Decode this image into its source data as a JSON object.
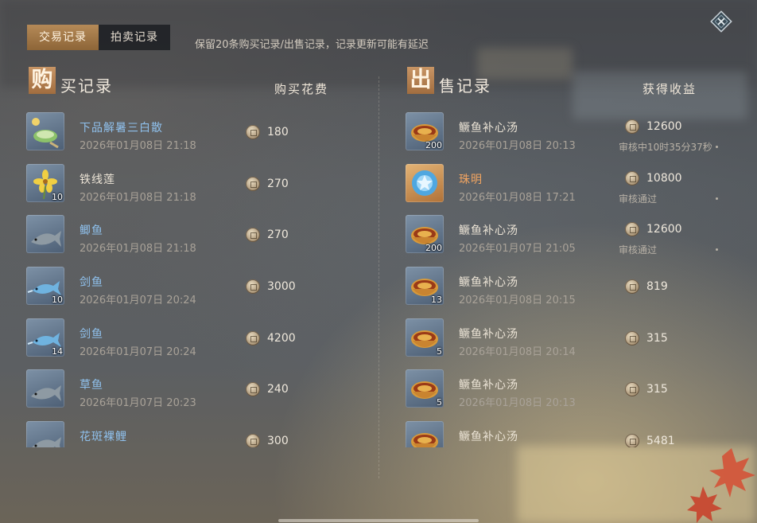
{
  "tabs": {
    "trade_records": "交易记录",
    "auction_records": "拍卖记录"
  },
  "notice": "保留20条购买记录/出售记录，记录更新可能有延迟",
  "buy": {
    "badge": "购",
    "title_rest": "买记录",
    "column": "购买花费",
    "items": [
      {
        "name": "下品解暑三白散",
        "time": "2026年01月08日 21:18",
        "price": "180",
        "count": "",
        "name_color": "blue",
        "icon": "herb-powder-icon"
      },
      {
        "name": "铁线莲",
        "time": "2026年01月08日 21:18",
        "price": "270",
        "count": "10",
        "name_color": "white",
        "icon": "flower-icon"
      },
      {
        "name": "鲫鱼",
        "time": "2026年01月08日 21:18",
        "price": "270",
        "count": "",
        "name_color": "blue",
        "icon": "fish-icon"
      },
      {
        "name": "剑鱼",
        "time": "2026年01月07日 20:24",
        "price": "3000",
        "count": "10",
        "name_color": "blue",
        "icon": "swordfish-icon"
      },
      {
        "name": "剑鱼",
        "time": "2026年01月07日 20:24",
        "price": "4200",
        "count": "14",
        "name_color": "blue",
        "icon": "swordfish-icon"
      },
      {
        "name": "草鱼",
        "time": "2026年01月07日 20:23",
        "price": "240",
        "count": "",
        "name_color": "blue",
        "icon": "fish-icon"
      },
      {
        "name": "花斑裸鲤",
        "time": "",
        "price": "300",
        "count": "",
        "name_color": "blue",
        "icon": "fish-icon"
      }
    ]
  },
  "sell": {
    "badge": "出",
    "title_rest": "售记录",
    "column": "获得收益",
    "items": [
      {
        "name": "鳜鱼补心汤",
        "time": "2026年01月08日 20:13",
        "price": "12600",
        "count": "200",
        "status": "审核中10时35分37秒",
        "name_color": "white",
        "icon": "soup-bowl-icon"
      },
      {
        "name": "珠明",
        "time": "2026年01月08日 17:21",
        "price": "10800",
        "count": "",
        "status": "审核通过",
        "name_color": "orange",
        "icon": "blue-pearl-icon"
      },
      {
        "name": "鳜鱼补心汤",
        "time": "2026年01月07日 21:05",
        "price": "12600",
        "count": "200",
        "status": "审核通过",
        "name_color": "white",
        "icon": "soup-bowl-icon"
      },
      {
        "name": "鳜鱼补心汤",
        "time": "2026年01月08日 20:15",
        "price": "819",
        "count": "13",
        "status": "",
        "name_color": "white",
        "icon": "soup-bowl-icon"
      },
      {
        "name": "鳜鱼补心汤",
        "time": "2026年01月08日 20:14",
        "price": "315",
        "count": "5",
        "status": "",
        "name_color": "white",
        "icon": "soup-bowl-icon"
      },
      {
        "name": "鳜鱼补心汤",
        "time": "2026年01月08日 20:13",
        "price": "315",
        "count": "5",
        "status": "",
        "name_color": "white",
        "icon": "soup-bowl-icon"
      },
      {
        "name": "鳜鱼补心汤",
        "time": "",
        "price": "5481",
        "count": "",
        "status": "",
        "name_color": "white",
        "icon": "soup-bowl-icon"
      }
    ]
  },
  "colors": {
    "accent": "#a9784a",
    "blue_name": "#8fc0ec",
    "orange_name": "#f2a561"
  }
}
